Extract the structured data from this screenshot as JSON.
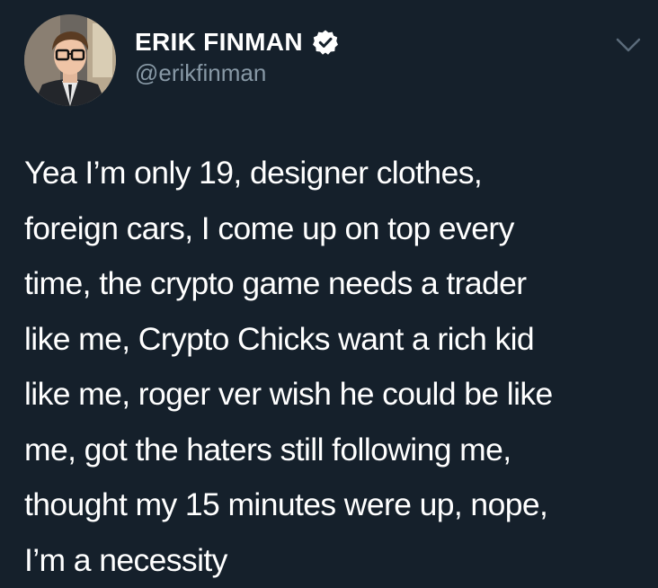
{
  "author": {
    "display_name": "ERIK FINMAN",
    "handle": "@erikfinman",
    "verified": true,
    "avatar_icon": "profile-photo"
  },
  "tweet": {
    "text": "Yea I’m only 19, designer clothes,\nforeign cars, I come up on top every\ntime, the crypto game needs a trader\nlike me, Crypto Chicks want a rich kid\nlike me, roger ver wish he could be like\nme, got the haters still following me,\nthought my 15 minutes were up, nope,\nI’m a necessity"
  },
  "actions": {
    "menu_icon": "chevron-down-icon"
  },
  "colors": {
    "background": "#15202b",
    "text_primary": "#ffffff",
    "text_secondary": "#8899a6",
    "verified_badge": "#ffffff"
  }
}
